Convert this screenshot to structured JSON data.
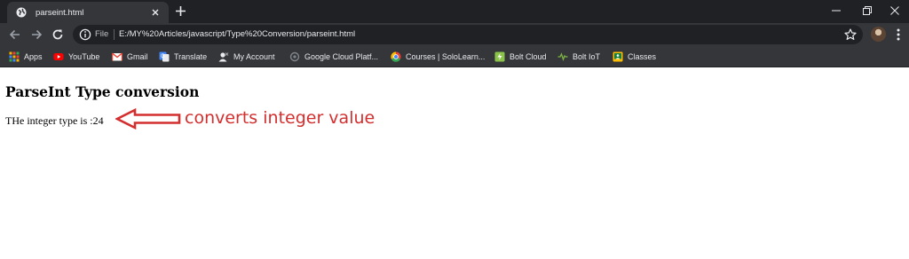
{
  "browser": {
    "tab": {
      "title": "parseint.html"
    },
    "address_bar": {
      "chip_label": "File",
      "url": "E:/MY%20Articles/javascript/Type%20Conversion/parseint.html"
    },
    "bookmarks": [
      {
        "label": "Apps",
        "icon": "apps-grid-icon",
        "color": "#f4b400"
      },
      {
        "label": "YouTube",
        "icon": "youtube-icon",
        "color": "#ff0000"
      },
      {
        "label": "Gmail",
        "icon": "gmail-icon",
        "color": "#ea4335"
      },
      {
        "label": "Translate",
        "icon": "translate-icon",
        "color": "#4285f4"
      },
      {
        "label": "My Account",
        "icon": "my-account-icon",
        "color": "#9aa0a6"
      },
      {
        "label": "Google Cloud Platf...",
        "icon": "google-cloud-icon",
        "color": "#80868b"
      },
      {
        "label": "Courses | SoloLearn...",
        "icon": "chrome-icon",
        "color": "#4285f4"
      },
      {
        "label": "Bolt Cloud",
        "icon": "bolt-cloud-icon",
        "color": "#8bc34a"
      },
      {
        "label": "Bolt IoT",
        "icon": "bolt-iot-icon",
        "color": "#7cb342"
      },
      {
        "label": "Classes",
        "icon": "classes-icon",
        "color": "#fbbc04"
      }
    ]
  },
  "page": {
    "heading": "ParseInt Type conversion",
    "text": "THe integer type is :24",
    "annotation": "converts integer value"
  },
  "colors": {
    "tab_strip": "#202124",
    "toolbar": "#35363a",
    "annotation_red": "#d32f2f"
  }
}
